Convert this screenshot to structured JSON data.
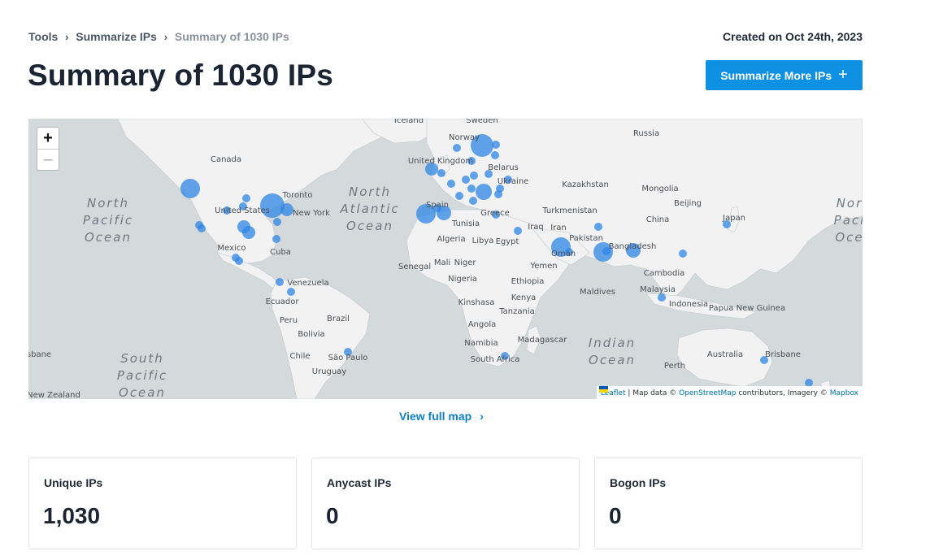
{
  "breadcrumb": {
    "items": [
      "Tools",
      "Summarize IPs"
    ],
    "current": "Summary of 1030 IPs"
  },
  "created": "Created on Oct 24th, 2023",
  "title": "Summary of 1030 IPs",
  "cta_label": "Summarize More IPs",
  "map": {
    "zoom_in": "+",
    "zoom_out": "–",
    "attribution": {
      "leaflet": "Leaflet",
      "map_data": " | Map data © ",
      "osm": "OpenStreetMap",
      "contrib": " contributors, Imagery © ",
      "mapbox": "Mapbox"
    },
    "place_labels": [
      "Iceland",
      "Sweden",
      "Norway",
      "Russia",
      "Canada",
      "United Kingdom",
      "Belarus",
      "Ukraine",
      "Kazakhstan",
      "Mongolia",
      "Toronto",
      "United States",
      "New York",
      "Spain",
      "Greece",
      "Turkmenistan",
      "Beijing",
      "China",
      "Japan",
      "Tunisia",
      "Iraq",
      "Iran",
      "Algeria",
      "Libya",
      "Egypt",
      "Pakistan",
      "Mexico",
      "Cuba",
      "Bangladesh",
      "Senegal",
      "Mali",
      "Niger",
      "Oman",
      "Yemen",
      "Nigeria",
      "Ethiopia",
      "Venezuela",
      "Ecuador",
      "Maldives",
      "Malaysia",
      "Cambodia",
      "Kinshasa",
      "Kenya",
      "Tanzania",
      "Indonesia",
      "Papua New Guinea",
      "Peru",
      "Brazil",
      "Bolivia",
      "Angola",
      "Namibia",
      "Madagascar",
      "Chile",
      "São Paulo",
      "Australia",
      "Brisbane",
      "Perth",
      "Uruguay",
      "South Africa",
      "New Zealand",
      "sbane"
    ],
    "oceans": [
      "North\nPacific\nOcean",
      "North\nAtlantic\nOcean",
      "South\nPacific\nOcean",
      "Indian\nOcean",
      "Nor\nPaci\nOce"
    ]
  },
  "view_full_map": "View full map",
  "stats": [
    {
      "label": "Unique IPs",
      "value": "1,030"
    },
    {
      "label": "Anycast IPs",
      "value": "0"
    },
    {
      "label": "Bogon IPs",
      "value": "0"
    }
  ],
  "colors": {
    "accent": "#0e91e3",
    "link": "#0e7fc8",
    "marker": "#2d86e6",
    "land": "#f2f2f2",
    "water": "#d4dadc"
  }
}
